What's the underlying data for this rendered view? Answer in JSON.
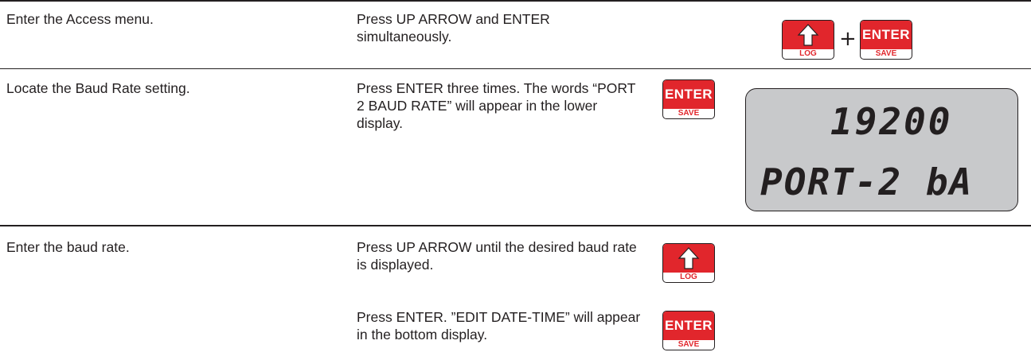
{
  "steps": [
    {
      "action": "Enter the Access menu.",
      "instruction": "Press UP ARROW and ENTER simultaneously.",
      "keys": [
        "up-arrow",
        "enter"
      ]
    },
    {
      "action": "Locate the Baud Rate setting.",
      "instruction": "Press ENTER three times. The words “PORT 2 BAUD RATE” will appear in the lower display.",
      "keys": [
        "enter"
      ],
      "display": {
        "upper": "19200",
        "lower": "PORT-2 bA"
      }
    },
    {
      "action": "Enter the baud rate.",
      "instructions": [
        "Press UP ARROW until the desired baud rate is displayed.",
        "Press ENTER. ”EDIT DATE-TIME” will appear in the bottom display."
      ],
      "keys": [
        "up-arrow",
        "enter"
      ]
    }
  ],
  "keys": {
    "enter_label": "ENTER",
    "enter_sub": "SAVE",
    "up_sub": "LOG",
    "plus": "+"
  },
  "colors": {
    "key_red": "#e1262c",
    "lcd_bg": "#c8c9cb",
    "text": "#231f20"
  }
}
